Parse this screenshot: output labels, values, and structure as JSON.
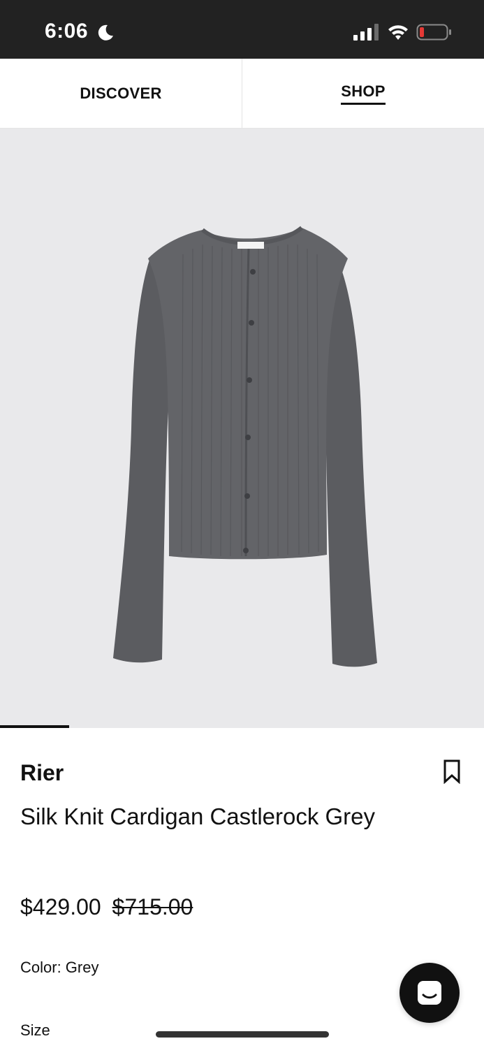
{
  "status_bar": {
    "time": "6:06",
    "icons": [
      "moon-icon",
      "cellular-signal-icon",
      "wifi-icon",
      "battery-low-icon"
    ],
    "battery_color": "#e53935"
  },
  "tabs": [
    {
      "label": "DISCOVER",
      "active": false
    },
    {
      "label": "SHOP",
      "active": true
    }
  ],
  "product": {
    "image_description": "grey ribbed knit cardigan",
    "brand": "Rier",
    "name": "Silk Knit Cardigan Castlerock Grey",
    "price_sale": "$429.00",
    "price_original": "$715.00",
    "color_label": "Color: Grey",
    "size_label": "Size"
  },
  "actions": {
    "bookmark_icon": "bookmark-icon",
    "chat_icon": "chat-icon"
  },
  "colors": {
    "status_bar_bg": "#222222",
    "image_bg": "#e9e9eb",
    "garment": "#5f6064",
    "chat_bg": "#111111"
  }
}
